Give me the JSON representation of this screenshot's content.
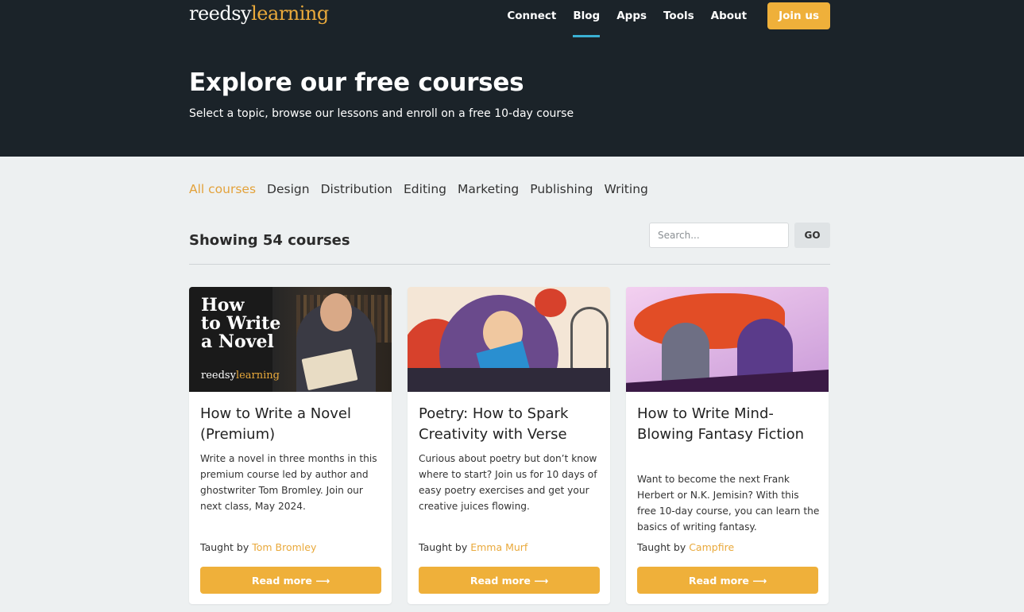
{
  "brand": {
    "logo_part1": "reedsy",
    "logo_part2": "learning"
  },
  "nav": {
    "items": [
      "Connect",
      "Blog",
      "Apps",
      "Tools",
      "About"
    ],
    "join_label": "Join us"
  },
  "hero": {
    "title": "Explore our free courses",
    "subtitle": "Select a topic, browse our lessons and enroll on a free 10-day course"
  },
  "filters": {
    "tabs": [
      "All courses",
      "Design",
      "Distribution",
      "Editing",
      "Marketing",
      "Publishing",
      "Writing"
    ],
    "active": "All courses"
  },
  "results": {
    "showing_text": "Showing 54 courses",
    "search_placeholder": "Search...",
    "go_label": "GO"
  },
  "cards": [
    {
      "title": "How to Write a Novel (Premium)",
      "description": "Write a novel in three months in this premium course led by author and ghostwriter Tom Bromley. Join our next class, May 2024.",
      "taught_by_label": "Taught by",
      "author": "Tom Bromley",
      "button": "Read more ⟶",
      "image_text_line1": "How",
      "image_text_line2": "to Write",
      "image_text_line3": "a Novel",
      "image_logo1": "reedsy",
      "image_logo2": "learning"
    },
    {
      "title": "Poetry: How to Spark Creativity with Verse",
      "description": "Curious about poetry but don’t know where to start? Join us for 10 days of easy poetry exercises and get your creative juices flowing.",
      "taught_by_label": "Taught by",
      "author": "Emma Murf",
      "button": "Read more ⟶"
    },
    {
      "title": "How to Write Mind-Blowing Fantasy Fiction",
      "description": "Want to become the next Frank Herbert or N.K. Jemisin? With this free 10-day course, you can learn the basics of writing fantasy.",
      "taught_by_label": "Taught by",
      "author": "Campfire",
      "button": "Read more ⟶"
    }
  ],
  "colors": {
    "header_bg": "#1b2329",
    "accent": "#efb03a",
    "active_tab": "#e3a23b",
    "nav_underline": "#3ab0d3"
  }
}
